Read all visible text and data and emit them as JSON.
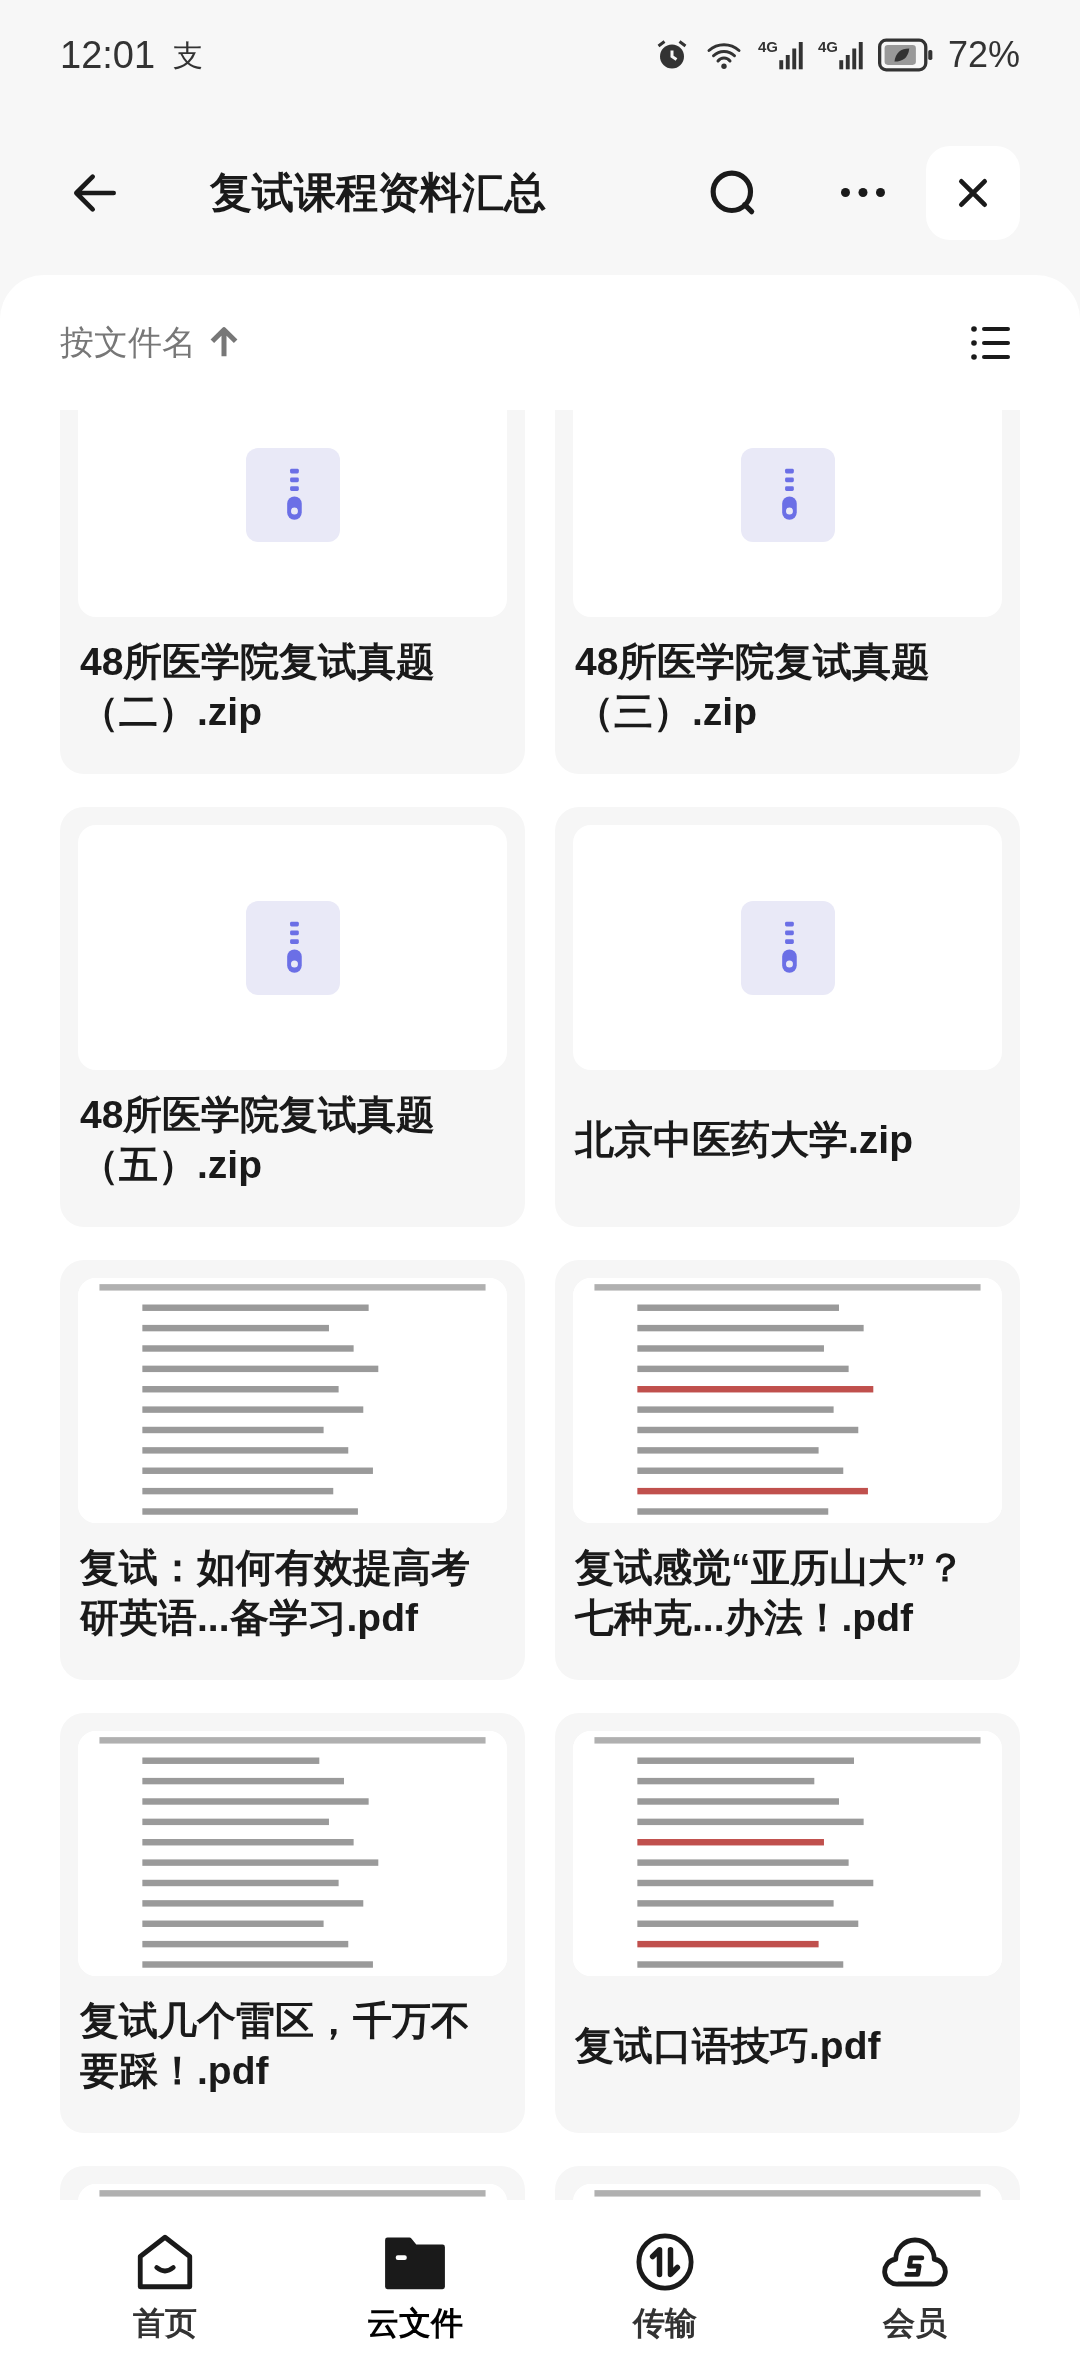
{
  "status_bar": {
    "time": "12:01",
    "carrier_mark": "支",
    "network_1": "4G",
    "network_2": "4G",
    "battery": "72%"
  },
  "header": {
    "title": "复试课程资料汇总"
  },
  "sort": {
    "label": "按文件名"
  },
  "files": [
    {
      "kind": "zip",
      "name": "48所医学院复试真题（二）.zip"
    },
    {
      "kind": "zip",
      "name": "48所医学院复试真题（三）.zip"
    },
    {
      "kind": "zip",
      "name": "48所医学院复试真题（五）.zip"
    },
    {
      "kind": "zip",
      "name": "北京中医药大学.zip"
    },
    {
      "kind": "pdf",
      "name": "复试：如何有效提高考研英语...备学习.pdf"
    },
    {
      "kind": "pdf",
      "name": "复试感觉“亚历山大”？七种克...办法！.pdf"
    },
    {
      "kind": "pdf",
      "name": "复试几个雷区，千万不要踩！.pdf"
    },
    {
      "kind": "pdf",
      "name": "复试口语技巧.pdf"
    },
    {
      "kind": "pdf"
    },
    {
      "kind": "pdf"
    }
  ],
  "nav": [
    {
      "label": "首页",
      "kind": "home",
      "selected": false
    },
    {
      "label": "云文件",
      "kind": "folder",
      "selected": true
    },
    {
      "label": "传输",
      "kind": "transfer",
      "selected": false
    },
    {
      "label": "会员",
      "kind": "member",
      "selected": false
    }
  ]
}
